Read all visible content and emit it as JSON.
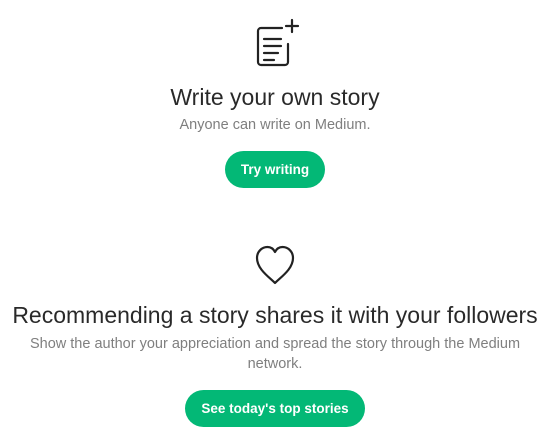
{
  "write_section": {
    "icon": "write-story-plus-icon",
    "title": "Write your own story",
    "subtitle": "Anyone can write on Medium.",
    "button_label": "Try writing"
  },
  "recommend_section": {
    "icon": "heart-icon",
    "title": "Recommending a story shares it with your followers",
    "subtitle": "Show the author your appreciation and spread the story through the Medium network.",
    "button_label": "See today's top stories"
  },
  "colors": {
    "accent": "#03b876",
    "text_primary": "rgba(0,0,0,0.84)",
    "text_secondary": "#7f7f7f",
    "background": "#ffffff"
  }
}
